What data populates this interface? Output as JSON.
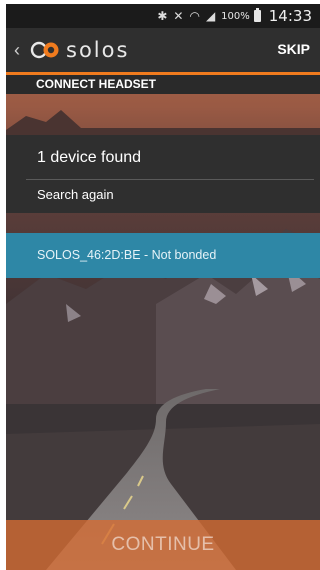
{
  "status_bar": {
    "icons": [
      "bluetooth-icon",
      "mute-icon",
      "wifi-icon",
      "signal-icon"
    ],
    "battery": "100%",
    "time": "14:33"
  },
  "app_bar": {
    "logo_text": "solos",
    "skip_label": "SKIP"
  },
  "section": {
    "title": "CONNECT HEADSET"
  },
  "search": {
    "result_text": "1 device found",
    "search_again_label": "Search again"
  },
  "devices": [
    {
      "label": "SOLOS_46:2D:BE - Not bonded"
    }
  ],
  "footer": {
    "continue_label": "CONTINUE"
  },
  "colors": {
    "accent": "#f07b1e",
    "selected_row": "#2e87a6",
    "continue_button": "#d66c32"
  }
}
